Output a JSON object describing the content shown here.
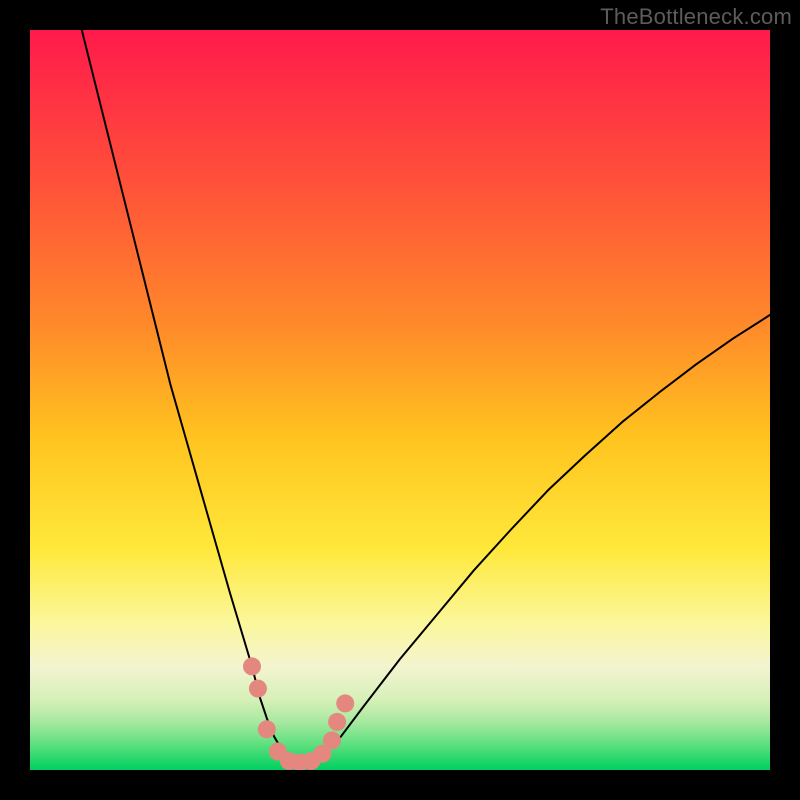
{
  "watermark": "TheBottleneck.com",
  "chart_data": {
    "type": "line",
    "title": "",
    "xlabel": "",
    "ylabel": "",
    "xlim": [
      0,
      100
    ],
    "ylim": [
      0,
      100
    ],
    "grid": false,
    "legend": false,
    "background_gradient_stops": [
      {
        "offset": 0.0,
        "color": "#ff1a4b"
      },
      {
        "offset": 0.2,
        "color": "#ff4f3a"
      },
      {
        "offset": 0.4,
        "color": "#ff8a2a"
      },
      {
        "offset": 0.55,
        "color": "#ffc31f"
      },
      {
        "offset": 0.7,
        "color": "#ffe83a"
      },
      {
        "offset": 0.8,
        "color": "#fbf79a"
      },
      {
        "offset": 0.86,
        "color": "#f4f4d0"
      },
      {
        "offset": 0.905,
        "color": "#d6f0b8"
      },
      {
        "offset": 0.935,
        "color": "#a7e9a0"
      },
      {
        "offset": 0.965,
        "color": "#5fe07f"
      },
      {
        "offset": 1.0,
        "color": "#00d060"
      }
    ],
    "series": [
      {
        "name": "bottleneck-curve",
        "color": "#000000",
        "stroke_width": 2,
        "x": [
          7,
          9,
          11,
          13,
          15,
          17,
          19,
          21,
          23,
          25,
          27,
          28.5,
          30,
          31,
          32,
          33,
          34,
          35,
          36,
          37,
          38,
          39,
          42,
          45,
          50,
          55,
          60,
          65,
          70,
          75,
          80,
          85,
          90,
          95,
          100
        ],
        "y": [
          100,
          92,
          84,
          76,
          68,
          60,
          52,
          45,
          38,
          31,
          24,
          19,
          14,
          10,
          7,
          4.5,
          2.8,
          1.6,
          0.9,
          0.6,
          0.9,
          1.6,
          4.5,
          8.5,
          15,
          21,
          27,
          32.5,
          37.8,
          42.5,
          47,
          51,
          54.8,
          58.3,
          61.5
        ]
      }
    ],
    "markers": {
      "name": "highlighted-points",
      "color": "#e4887f",
      "radius": 9,
      "x": [
        30.0,
        30.8,
        32.0,
        33.5,
        35.0,
        36.5,
        38.0,
        39.5,
        40.8,
        41.5,
        42.6
      ],
      "y": [
        14.0,
        11.0,
        5.5,
        2.5,
        1.2,
        1.0,
        1.2,
        2.2,
        4.0,
        6.5,
        9.0
      ]
    }
  }
}
